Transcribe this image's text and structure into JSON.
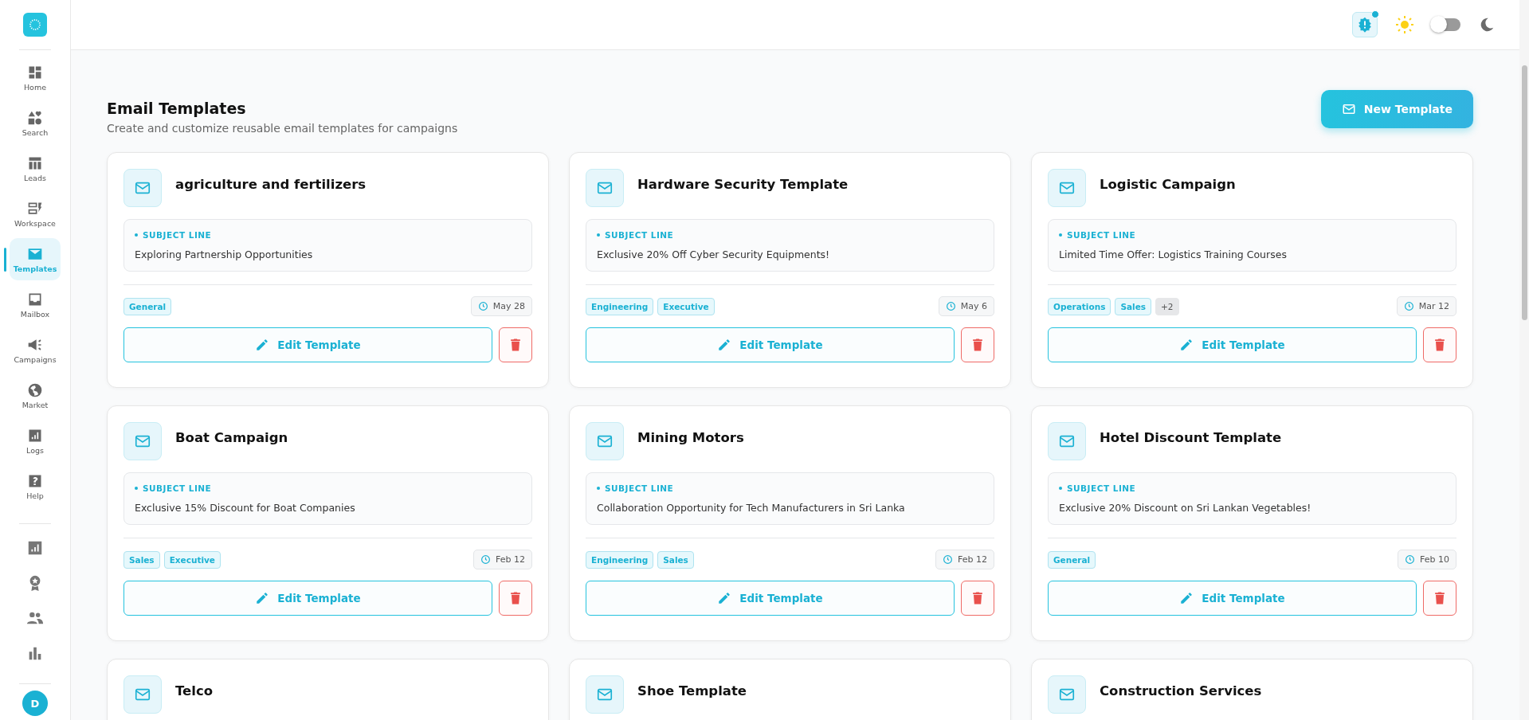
{
  "sidebar": {
    "items": [
      {
        "label": "Home",
        "selected": false
      },
      {
        "label": "Search",
        "selected": false
      },
      {
        "label": "Leads",
        "selected": false
      },
      {
        "label": "Workspace",
        "selected": false
      },
      {
        "label": "Templates",
        "selected": true
      },
      {
        "label": "Mailbox",
        "selected": false
      },
      {
        "label": "Campaigns",
        "selected": false
      },
      {
        "label": "Market",
        "selected": false
      },
      {
        "label": "Logs",
        "selected": false
      },
      {
        "label": "Help",
        "selected": false
      }
    ],
    "avatar": "D"
  },
  "header": {
    "notification_dot": true,
    "dark_mode": false
  },
  "page": {
    "title": "Email Templates",
    "subtitle": "Create and customize reusable email templates for campaigns",
    "new_button": "New Template"
  },
  "templates": [
    {
      "name": "agriculture and fertilizers",
      "subject_label": "SUBJECT LINE",
      "subject": "Exploring Partnership Opportunities",
      "tags": [
        "General"
      ],
      "date": "May 28",
      "edit": "Edit Template"
    },
    {
      "name": "Hardware Security Template",
      "subject_label": "SUBJECT LINE",
      "subject": "Exclusive 20% Off Cyber Security Equipments!",
      "tags": [
        "Engineering",
        "Executive"
      ],
      "date": "May 6",
      "edit": "Edit Template"
    },
    {
      "name": "Logistic Campaign",
      "subject_label": "SUBJECT LINE",
      "subject": "Limited Time Offer: Logistics Training Courses",
      "tags": [
        "Operations",
        "Sales"
      ],
      "more": "+2",
      "date": "Mar 12",
      "edit": "Edit Template"
    },
    {
      "name": "Boat Campaign",
      "subject_label": "SUBJECT LINE",
      "subject": "Exclusive 15% Discount for Boat Companies",
      "tags": [
        "Sales",
        "Executive"
      ],
      "date": "Feb 12",
      "edit": "Edit Template"
    },
    {
      "name": "Mining Motors",
      "subject_label": "SUBJECT LINE",
      "subject": "Collaboration Opportunity for Tech Manufacturers in Sri Lanka",
      "tags": [
        "Engineering",
        "Sales"
      ],
      "date": "Feb 12",
      "edit": "Edit Template"
    },
    {
      "name": "Hotel Discount Template",
      "subject_label": "SUBJECT LINE",
      "subject": "Exclusive 20% Discount on Sri Lankan Vegetables!",
      "tags": [
        "General"
      ],
      "date": "Feb 10",
      "edit": "Edit Template"
    },
    {
      "name": "Telco"
    },
    {
      "name": "Shoe Template"
    },
    {
      "name": "Construction Services"
    }
  ]
}
